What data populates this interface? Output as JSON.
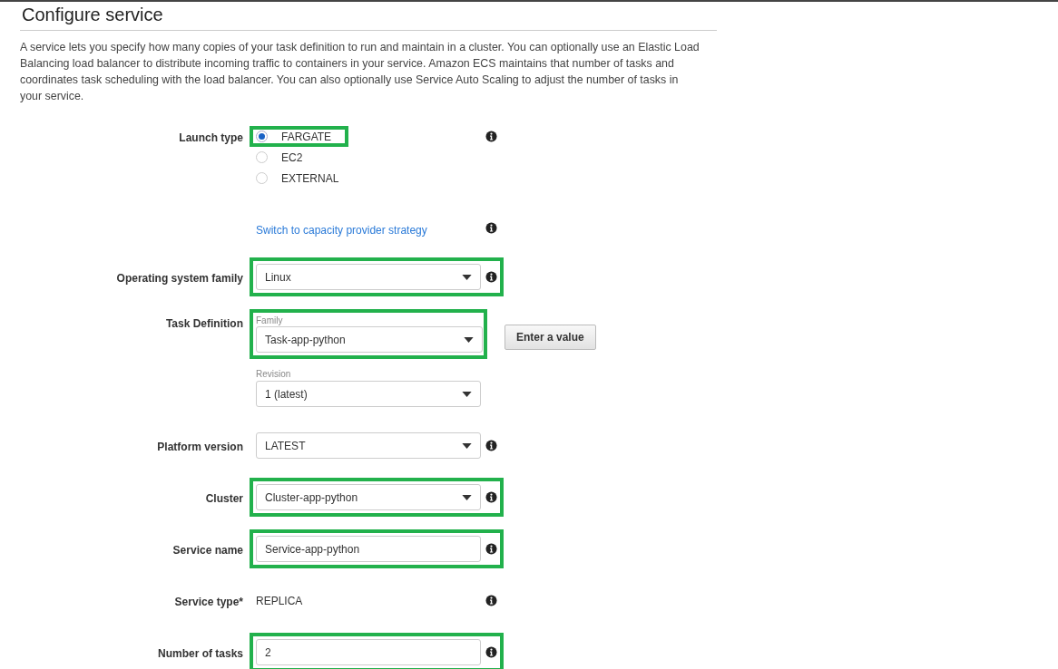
{
  "title": "Configure service",
  "description": "A service lets you specify how many copies of your task definition to run and maintain in a cluster. You can optionally use an Elastic Load Balancing load balancer to distribute incoming traffic to containers in your service. Amazon ECS maintains that number of tasks and coordinates task scheduling with the load balancer. You can also optionally use Service Auto Scaling to adjust the number of tasks in your service.",
  "fields": [
    {
      "kind": "radio",
      "label": "Launch type",
      "info": true,
      "options": [
        {
          "label": "FARGATE",
          "selected": true,
          "highlighted": true
        },
        {
          "label": "EC2",
          "selected": false,
          "highlighted": false
        },
        {
          "label": "EXTERNAL",
          "selected": false,
          "highlighted": false
        }
      ]
    },
    {
      "kind": "link",
      "text": "Switch to capacity provider strategy",
      "info": true
    },
    {
      "kind": "select",
      "label": "Operating system family",
      "value": "Linux",
      "info": true,
      "highlighted": true
    },
    {
      "kind": "taskdef",
      "label": "Task Definition",
      "family": {
        "label": "Family",
        "value": "Task-app-python",
        "highlighted": true
      },
      "button": "Enter a value",
      "revision": {
        "label": "Revision",
        "value": "1 (latest)"
      }
    },
    {
      "kind": "select",
      "label": "Platform version",
      "value": "LATEST",
      "info": true,
      "highlighted": false
    },
    {
      "kind": "select",
      "label": "Cluster",
      "value": "Cluster-app-python",
      "info": true,
      "highlighted": true
    },
    {
      "kind": "input",
      "label": "Service name",
      "value": "Service-app-python",
      "info": true,
      "highlighted": true
    },
    {
      "kind": "static",
      "label": "Service type*",
      "value": "REPLICA",
      "info": true
    },
    {
      "kind": "input",
      "label": "Number of tasks",
      "value": "2",
      "info": true,
      "highlighted": true
    }
  ]
}
